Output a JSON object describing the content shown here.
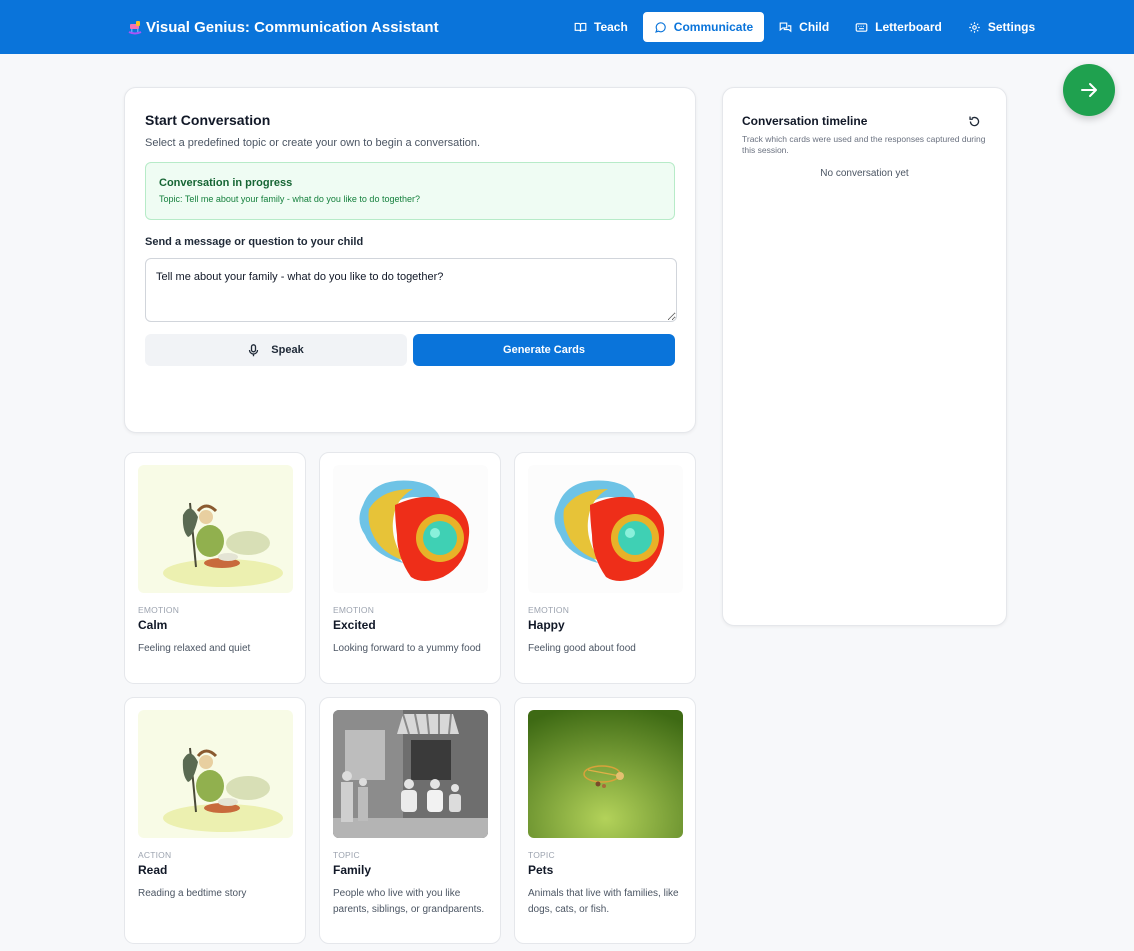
{
  "header": {
    "title": "Visual Genius: Communication Assistant",
    "nav": [
      {
        "label": "Teach",
        "icon": "book-open-icon"
      },
      {
        "label": "Communicate",
        "icon": "chat-bubble-icon",
        "active": true
      },
      {
        "label": "Child",
        "icon": "messages-icon"
      },
      {
        "label": "Letterboard",
        "icon": "keyboard-icon"
      },
      {
        "label": "Settings",
        "icon": "gear-icon"
      }
    ],
    "accent_color": "#0a74da"
  },
  "start": {
    "title": "Start Conversation",
    "description": "Select a predefined topic or create your own to begin a conversation.",
    "status_title": "Conversation in progress",
    "status_topic": "Topic: Tell me about your family - what do you like to do together?",
    "message_label": "Send a message or question to your child",
    "message_value": "Tell me about your family - what do you like to do together?",
    "speak_label": "Speak",
    "generate_label": "Generate Cards"
  },
  "timeline": {
    "title": "Conversation timeline",
    "description": "Track which cards were used and the responses captured during this session.",
    "empty": "No conversation yet"
  },
  "cards": [
    {
      "category": "EMOTION",
      "name": "Calm",
      "description": "Feeling relaxed and quiet",
      "image": "umbrella-person-illustration"
    },
    {
      "category": "EMOTION",
      "name": "Excited",
      "description": "Looking forward to a yummy food",
      "image": "abstract-swirl-illustration"
    },
    {
      "category": "EMOTION",
      "name": "Happy",
      "description": "Feeling good about food",
      "image": "abstract-swirl-illustration"
    },
    {
      "category": "ACTION",
      "name": "Read",
      "description": "Reading a bedtime story",
      "image": "umbrella-person-illustration"
    },
    {
      "category": "TOPIC",
      "name": "Family",
      "description": "People who live with you like parents, siblings, or grandparents.",
      "image": "family-photo"
    },
    {
      "category": "TOPIC",
      "name": "Pets",
      "description": "Animals that live with families, like dogs, cats, or fish.",
      "image": "green-brooch-photo"
    }
  ]
}
